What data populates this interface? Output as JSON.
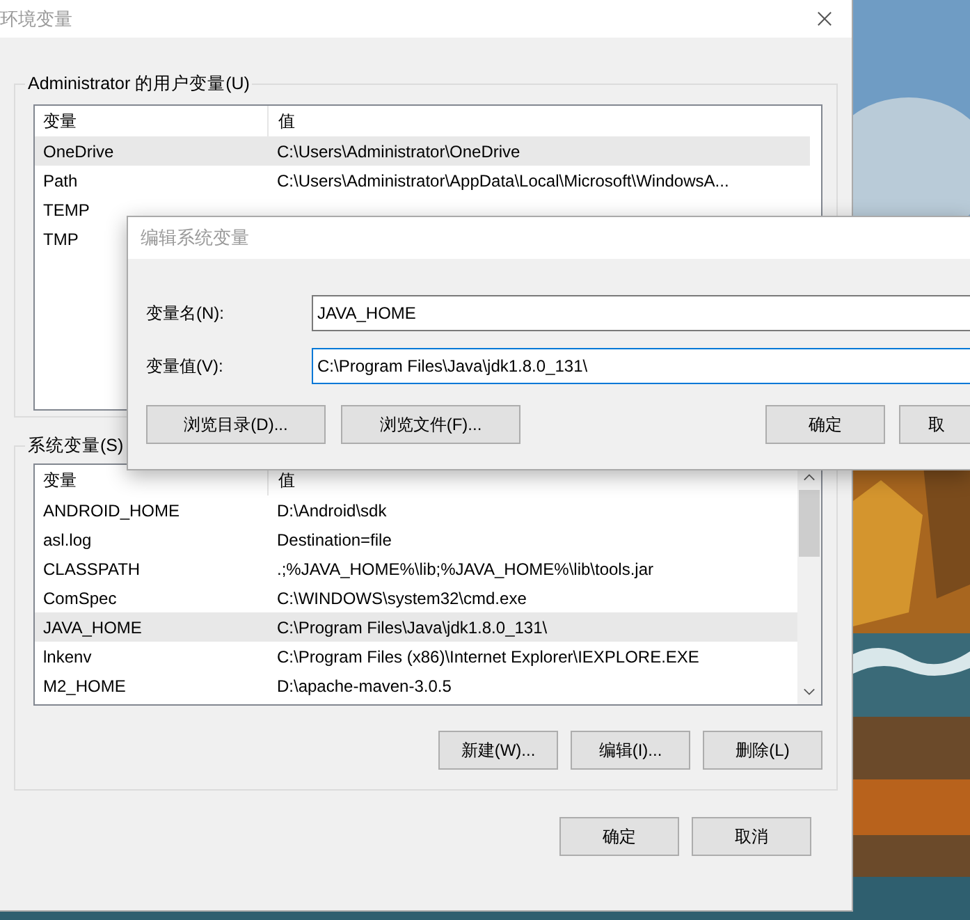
{
  "window": {
    "title": "环境变量"
  },
  "user_variables": {
    "title": "Administrator 的用户变量(U)",
    "columns": [
      "变量",
      "值"
    ],
    "rows": [
      {
        "name": "OneDrive",
        "value": "C:\\Users\\Administrator\\OneDrive",
        "selected": true
      },
      {
        "name": "Path",
        "value": "C:\\Users\\Administrator\\AppData\\Local\\Microsoft\\WindowsA...",
        "selected": false
      },
      {
        "name": "TEMP",
        "selected": false
      },
      {
        "name": "TMP",
        "selected": false
      }
    ]
  },
  "system_variables": {
    "title": "系统变量(S)",
    "columns": [
      "变量",
      "值"
    ],
    "rows": [
      {
        "name": "ANDROID_HOME",
        "value": "D:\\Android\\sdk",
        "selected": false
      },
      {
        "name": "asl.log",
        "value": "Destination=file",
        "selected": false
      },
      {
        "name": "CLASSPATH",
        "value": ".;%JAVA_HOME%\\lib;%JAVA_HOME%\\lib\\tools.jar",
        "selected": false
      },
      {
        "name": "ComSpec",
        "value": "C:\\WINDOWS\\system32\\cmd.exe",
        "selected": false
      },
      {
        "name": "JAVA_HOME",
        "value": "C:\\Program Files\\Java\\jdk1.8.0_131\\",
        "selected": true
      },
      {
        "name": "lnkenv",
        "value": "C:\\Program Files (x86)\\Internet Explorer\\IEXPLORE.EXE",
        "selected": false
      },
      {
        "name": "M2_HOME",
        "value": "D:\\apache-maven-3.0.5",
        "selected": false
      }
    ],
    "buttons": [
      "新建(W)...",
      "编辑(I)...",
      "删除(L)"
    ]
  },
  "buttons": [
    "确定",
    "取消"
  ],
  "edit_dialog": {
    "title": "编辑系统变量",
    "fields": [
      {
        "label": "变量名(N):",
        "value": "JAVA_HOME",
        "focused": false
      },
      {
        "label": "变量值(V):",
        "value": "C:\\Program Files\\Java\\jdk1.8.0_131\\",
        "focused": true
      }
    ],
    "buttons": [
      "浏览目录(D)...",
      "浏览文件(F)...",
      "确定",
      "取"
    ]
  }
}
